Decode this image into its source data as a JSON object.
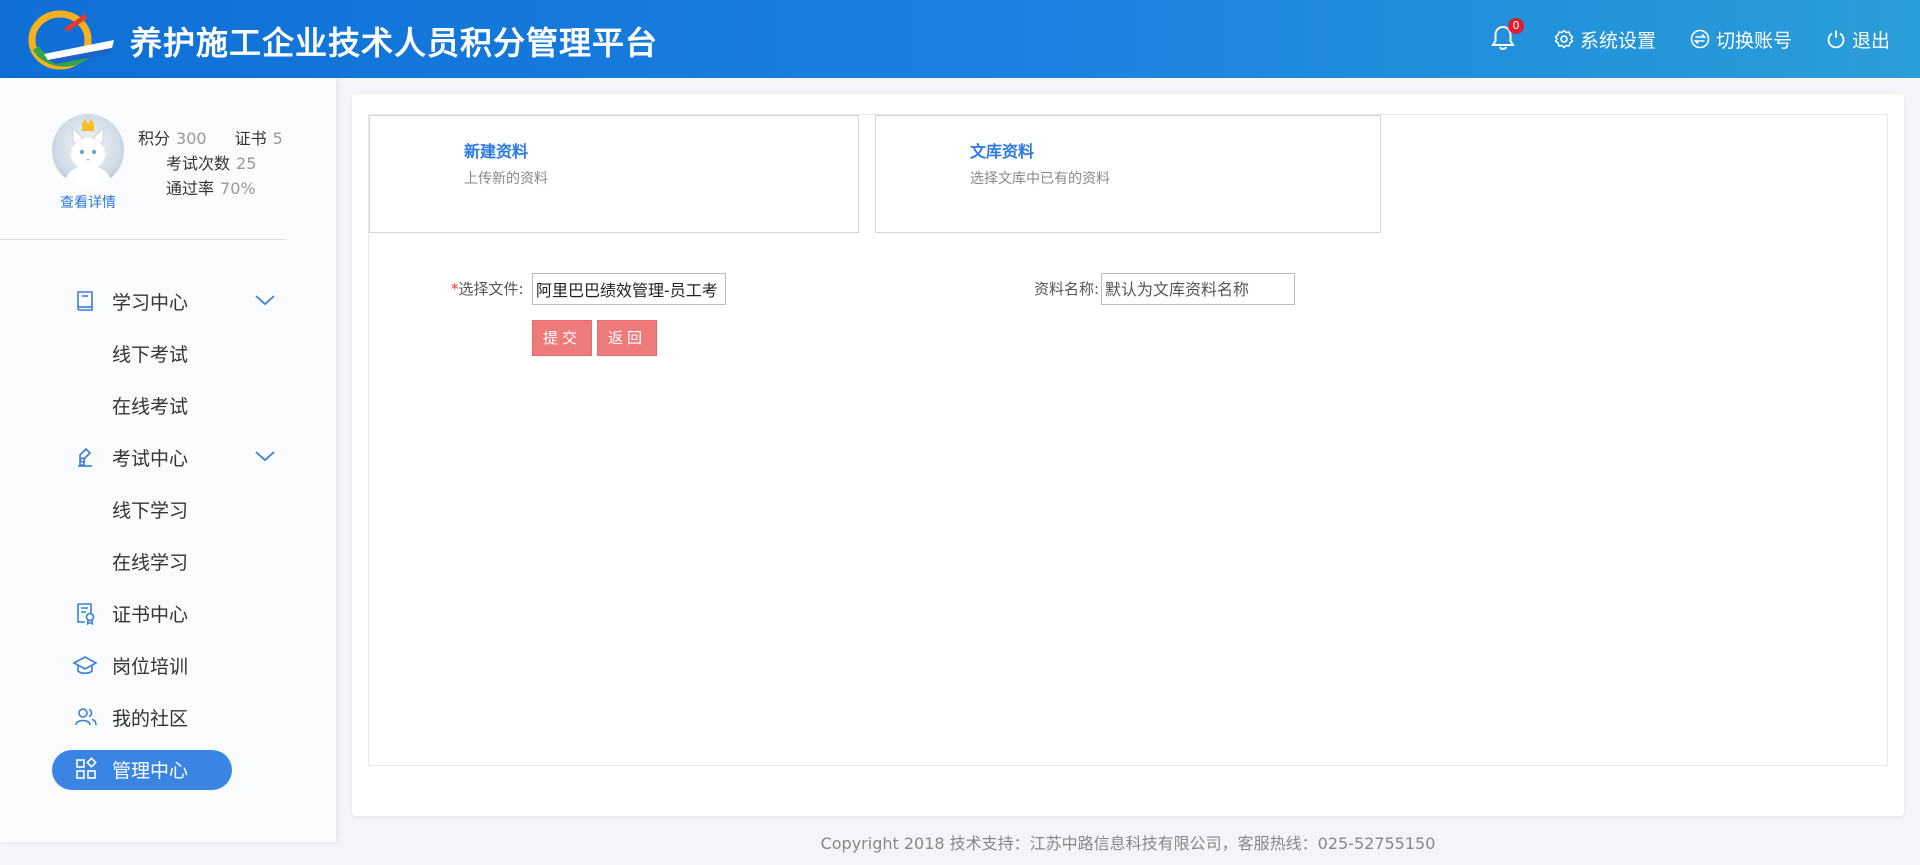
{
  "header": {
    "title": "养护施工企业技术人员积分管理平台",
    "notification_count": "0",
    "settings_label": "系统设置",
    "switch_account_label": "切换账号",
    "logout_label": "退出"
  },
  "profile": {
    "view_detail": "查看详情",
    "points_label": "积分",
    "points_value": "300",
    "cert_label": "证书",
    "cert_value": "5",
    "exam_count_label": "考试次数",
    "exam_count_value": "25",
    "pass_rate_label": "通过率",
    "pass_rate_value": "70%"
  },
  "menu": [
    {
      "label": "学习中心",
      "icon": "book-icon",
      "expandable": true
    },
    {
      "label": "线下考试",
      "sub": true
    },
    {
      "label": "在线考试",
      "sub": true
    },
    {
      "label": "考试中心",
      "icon": "exam-icon",
      "expandable": true
    },
    {
      "label": "线下学习",
      "sub": true
    },
    {
      "label": "在线学习",
      "sub": true
    },
    {
      "label": "证书中心",
      "icon": "certificate-icon"
    },
    {
      "label": "岗位培训",
      "icon": "graduation-cap-icon"
    },
    {
      "label": "我的社区",
      "icon": "community-icon"
    },
    {
      "label": "管理中心",
      "icon": "grid-icon",
      "active": true
    }
  ],
  "cards": {
    "new": {
      "title": "新建资料",
      "subtitle": "上传新的资料"
    },
    "library": {
      "title": "文库资料",
      "subtitle": "选择文库中已有的资料"
    }
  },
  "form": {
    "required_mark": "*",
    "file_label": "选择文件:",
    "file_value": "阿里巴巴绩效管理-员工考",
    "name_label": "资料名称:",
    "name_placeholder": "默认为文库资料名称",
    "submit_label": "提交",
    "back_label": "返回"
  },
  "footer": {
    "text": "Copyright 2018 技术支持：江苏中路信息科技有限公司，客服热线：025-52755150"
  },
  "colors": {
    "header_start": "#0f6fd6",
    "header_end": "#2a9ed8",
    "accent": "#3a85e4",
    "card_title": "#2c7be5",
    "button": "#ef7a7a",
    "badge": "#e11d2e"
  }
}
